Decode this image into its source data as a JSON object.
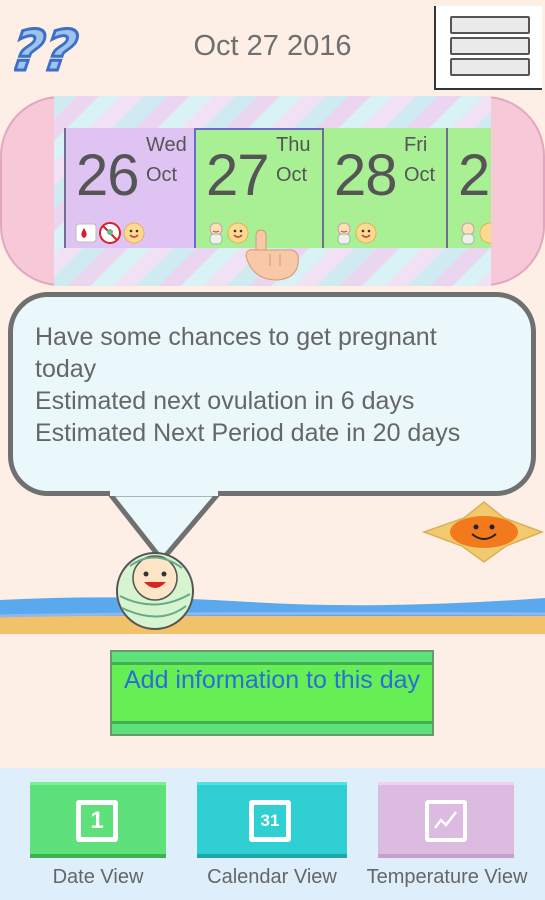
{
  "header": {
    "title": "Oct 27 2016"
  },
  "days": [
    {
      "num": "26",
      "weekday": "Wed",
      "month": "Oct"
    },
    {
      "num": "27",
      "weekday": "Thu",
      "month": "Oct"
    },
    {
      "num": "28",
      "weekday": "Fri",
      "month": "Oct"
    },
    {
      "num": "2"
    }
  ],
  "message": {
    "line1": "Have some chances to get pregnant",
    "line2": "today",
    "line3": "Estimated next ovulation in 6 days",
    "line4": "Estimated Next Period date in 20 days"
  },
  "add_button": {
    "label": "Add information to this day"
  },
  "bottom_nav": [
    {
      "label": "Date View",
      "icon_text": "1"
    },
    {
      "label": "Calendar View",
      "icon_text": "31"
    },
    {
      "label": "Temperature View"
    }
  ],
  "colors": {
    "day_past": "#dfc4f3",
    "day_fertile": "#a8f093",
    "nav_date": "#5ee07a",
    "nav_calendar": "#2fcfd2",
    "nav_temperature": "#dcbbe0"
  }
}
